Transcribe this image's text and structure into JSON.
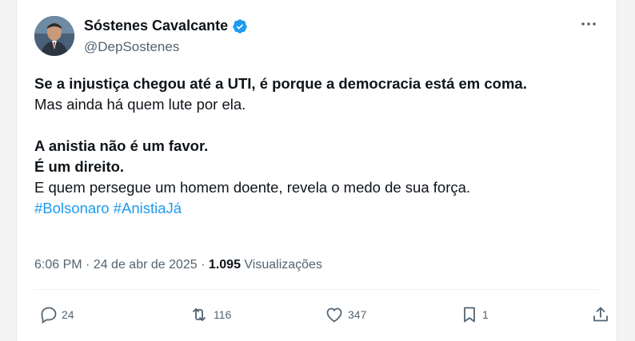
{
  "author": {
    "name": "Sóstenes Cavalcante",
    "handle": "@DepSostenes",
    "verified": true
  },
  "tweet": {
    "lines": [
      {
        "text": "Se a injustiça chegou até a UTI, é porque a democracia está em coma.",
        "bold": true
      },
      {
        "text": "Mas ainda há quem lute por ela.",
        "bold": false
      },
      {
        "text": "",
        "bold": false
      },
      {
        "text": "A anistia não é um favor.",
        "bold": true
      },
      {
        "text": "É um direito.",
        "bold": true
      },
      {
        "text": "E quem persegue um homem doente, revela o medo de sua força.",
        "bold": false
      }
    ],
    "hashtags": "#Bolsonaro #AnistiaJá"
  },
  "meta": {
    "time_date": "6:06 PM · 24 de abr de 2025 · ",
    "views_count": "1.095",
    "views_label": " Visualizações"
  },
  "actions": {
    "replies": "24",
    "reposts": "116",
    "likes": "347",
    "bookmarks": "1"
  },
  "colors": {
    "accent": "#1d9bf0",
    "text": "#0f1419",
    "secondary": "#536471"
  },
  "icons": [
    "verified-badge-icon",
    "more-icon",
    "reply-icon",
    "repost-icon",
    "like-icon",
    "bookmark-icon",
    "share-icon"
  ]
}
